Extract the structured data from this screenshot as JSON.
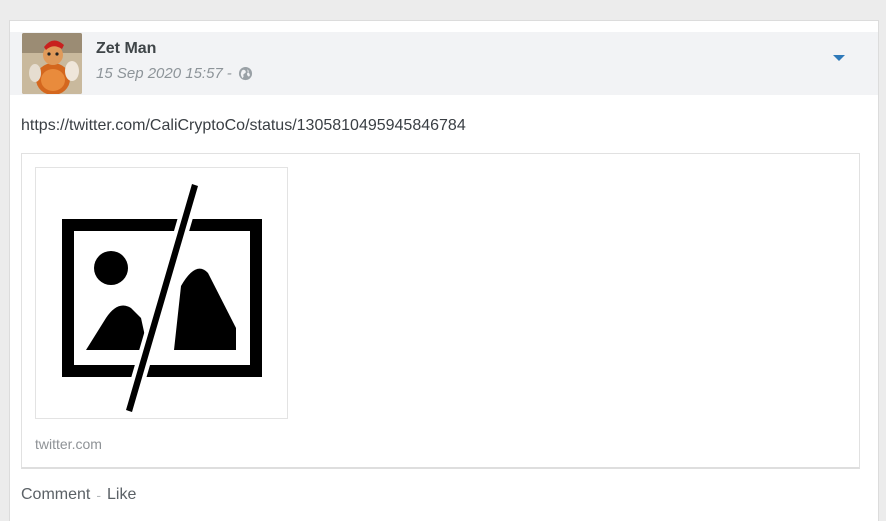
{
  "post": {
    "author": "Zet Man",
    "timestamp": "15 Sep 2020 15:57",
    "meta_separator": "-",
    "visibility_icon": "globe-icon",
    "menu_icon": "caret-down-icon",
    "text": "https://twitter.com/CaliCryptoCo/status/1305810495945846784",
    "link_preview": {
      "thumbnail_icon": "broken-image-icon",
      "domain": "twitter.com"
    },
    "actions": {
      "comment_label": "Comment",
      "separator": "-",
      "like_label": "Like"
    }
  },
  "colors": {
    "header_bg": "#f2f3f5",
    "accent": "#2f79b9",
    "muted_text": "#8d9499"
  }
}
